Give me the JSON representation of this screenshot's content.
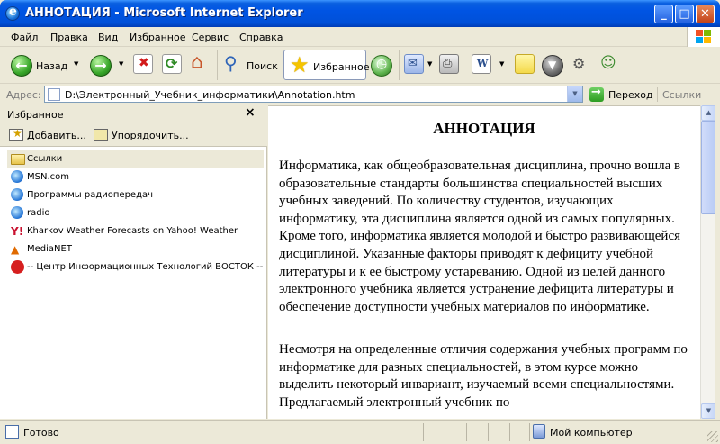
{
  "window": {
    "title": "АННОТАЦИЯ - Microsoft Internet Explorer"
  },
  "menu": {
    "items": [
      "Файл",
      "Правка",
      "Вид",
      "Избранное",
      "Сервис",
      "Справка"
    ]
  },
  "toolbar": {
    "back_label": "Назад",
    "search_label": "Поиск",
    "favorites_label": "Избранное"
  },
  "address": {
    "label": "Адрес:",
    "value": "D:\\Электронный_Учебник_информатики\\Annotation.htm",
    "go_label": "Переход",
    "links_label": "Ссылки"
  },
  "favorites": {
    "title": "Избранное",
    "add_label": "Добавить...",
    "organize_label": "Упорядочить...",
    "items": [
      {
        "label": "Ссылки",
        "icon": "folder-icon"
      },
      {
        "label": "MSN.com",
        "icon": "ie-page-icon"
      },
      {
        "label": "Программы радиопередач",
        "icon": "ie-page-icon"
      },
      {
        "label": "radio",
        "icon": "ie-page-icon"
      },
      {
        "label": "Kharkov Weather Forecasts on Yahoo! Weather",
        "icon": "yahoo-icon"
      },
      {
        "label": "MediaNET",
        "icon": "medianet-icon"
      },
      {
        "label": "-- Центр Информационных Технологий ВОСТОК  --",
        "icon": "vostok-icon"
      }
    ]
  },
  "document": {
    "title": "АННОТАЦИЯ",
    "paragraph1": "Информатика, как общеобразовательная дисциплина, прочно вошла в образовательные стандарты большинства специальностей высших учебных заведений. По количеству студентов, изучающих информатику, эта дисциплина является одной из самых популярных. Кроме того, информатика является молодой и быстро развивающейся дисциплиной. Указанные факторы приводят к дефициту учебной литературы и к ее быстрому устареванию. Одной из целей данного электронного учебника является устранение дефицита литературы и обеспечение доступности учебных материалов по информатике.",
    "paragraph2": "Несмотря на определенные отличия содержания учебных программ по информатике для разных специальностей, в этом курсе можно выделить некоторый инвариант, изучаемый всеми специальностями. Предлагаемый электронный учебник по"
  },
  "status": {
    "text": "Готово",
    "zone": "Мой компьютер"
  }
}
